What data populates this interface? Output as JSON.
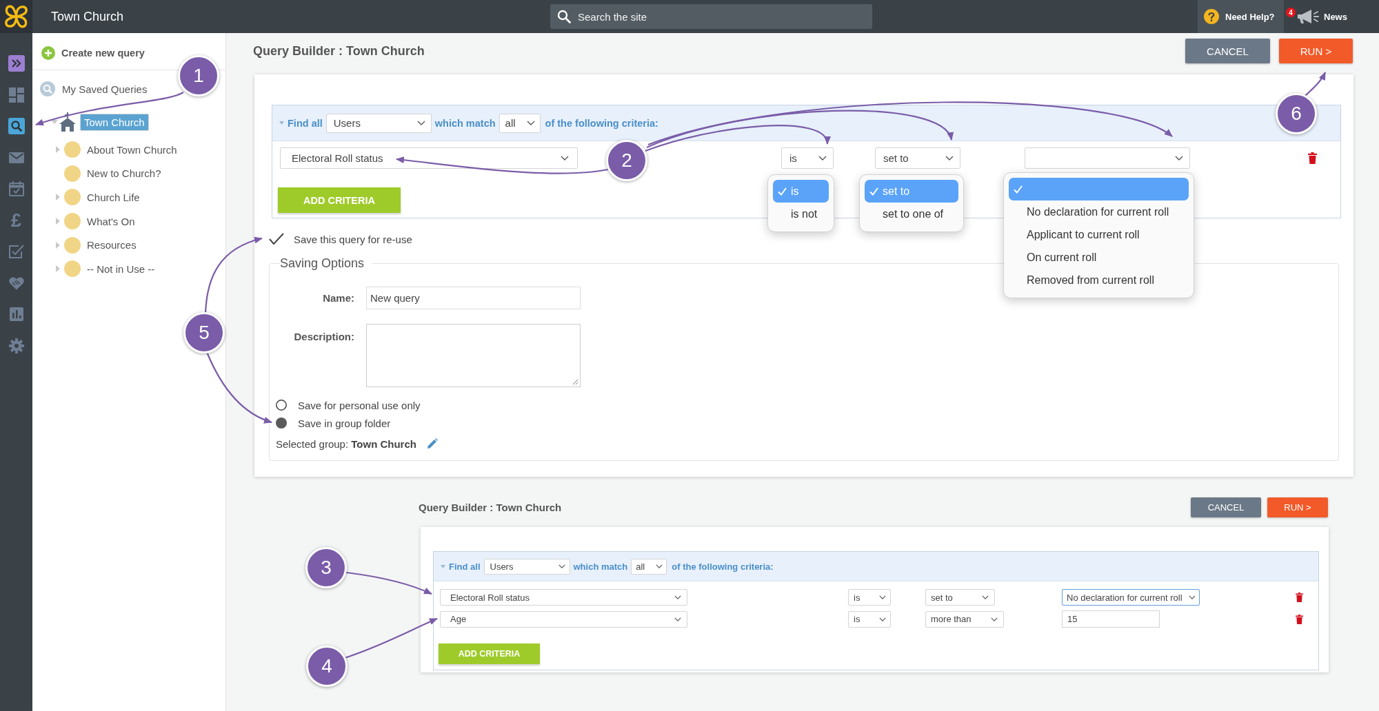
{
  "top_bar": {
    "title": "Town Church",
    "search": {
      "placeholder": "Search the site"
    },
    "help": "Need Help?",
    "news": {
      "label": "News",
      "badge": "4"
    }
  },
  "nav_rail": [
    {
      "kind": "expand",
      "selected": false
    },
    {
      "kind": "dashboard",
      "selected": false
    },
    {
      "kind": "search",
      "selected": true
    },
    {
      "kind": "mail",
      "selected": false
    },
    {
      "kind": "calendar",
      "selected": false
    },
    {
      "kind": "glyph",
      "glyph": "£",
      "selected": false
    },
    {
      "kind": "tasks",
      "selected": false
    },
    {
      "kind": "heart",
      "selected": false
    },
    {
      "kind": "chart",
      "selected": false
    },
    {
      "kind": "settings",
      "selected": false
    }
  ],
  "sidebar": {
    "create_query": "Create new query",
    "saved_queries": "My Saved Queries",
    "tree": [
      {
        "label": "Town Church",
        "selected": true,
        "expanded": true,
        "children": [
          {
            "label": "About Town Church",
            "selected": false,
            "expanded": false,
            "has_children": true
          },
          {
            "label": "New to Church?",
            "selected": false,
            "expanded": false,
            "has_children": false
          },
          {
            "label": "Church Life",
            "selected": false,
            "expanded": false,
            "has_children": true
          },
          {
            "label": "What's On",
            "selected": false,
            "expanded": false,
            "has_children": true
          },
          {
            "label": "Resources",
            "selected": false,
            "expanded": false,
            "has_children": true
          },
          {
            "label": "-- Not in Use --",
            "selected": false,
            "expanded": false,
            "has_children": true
          }
        ]
      }
    ]
  },
  "query_builder": {
    "title": "Query Builder : Town Church",
    "buttons": [
      {
        "label": "CANCEL",
        "kind": "cancel"
      },
      {
        "label": "RUN >",
        "kind": "run"
      }
    ],
    "header": {
      "find_label": "Find all",
      "entity": "Users",
      "match_label": "which match",
      "match": "all",
      "suffix": "of the following criteria:"
    },
    "criteria": [
      {
        "field": "Electoral Roll status",
        "operator": {
          "value": "is",
          "options": [
            {
              "label": "is",
              "selected": true
            },
            {
              "label": "is not",
              "selected": false
            }
          ]
        },
        "condition": {
          "value": "set to",
          "options": [
            {
              "label": "set to",
              "selected": true
            },
            {
              "label": "set to one of",
              "selected": false
            }
          ]
        },
        "value": {
          "kind": "select",
          "focused": false,
          "options": [
            {
              "selected": true
            },
            {
              "label": "No declaration for current roll",
              "selected": false
            },
            {
              "label": "Applicant to current roll",
              "selected": false
            },
            {
              "label": "On current roll",
              "selected": false
            },
            {
              "label": "Removed from current roll",
              "selected": false
            }
          ]
        }
      }
    ],
    "add_button": "ADD CRITERIA",
    "save_query": {
      "label": "Save this query for re-use",
      "checked": true
    },
    "saving_options": {
      "legend": "Saving Options",
      "name": {
        "label": "Name:",
        "value": "New query"
      },
      "description": {
        "label": "Description:"
      },
      "scope": [
        {
          "label": "Save for personal use only",
          "selected": false
        },
        {
          "label": "Save in group folder",
          "selected": true
        }
      ],
      "selected_group": "Selected group: **Town Church**"
    }
  },
  "example": {
    "title": "Query Builder : Town Church",
    "buttons": [
      {
        "label": "CANCEL",
        "kind": "cancel"
      },
      {
        "label": "RUN >",
        "kind": "run"
      }
    ],
    "header": {
      "find_label": "Find all",
      "entity": "Users",
      "match_label": "which match",
      "match": "all",
      "suffix": "of the following criteria:"
    },
    "criteria": [
      {
        "field": "Electoral Roll status",
        "operator": {
          "value": "is"
        },
        "condition": {
          "value": "set to"
        },
        "value": {
          "kind": "select",
          "text": "No declaration for current roll",
          "focused": true
        }
      },
      {
        "field": "Age",
        "operator": {
          "value": "is"
        },
        "condition": {
          "value": "more than"
        },
        "value": {
          "kind": "input",
          "text": "15",
          "focused": false
        }
      }
    ],
    "add_button": "ADD CRITERIA"
  },
  "annotations": [
    {
      "number": "1"
    },
    {
      "number": "2"
    },
    {
      "number": "3"
    },
    {
      "number": "4"
    },
    {
      "number": "5"
    },
    {
      "number": "6"
    }
  ]
}
